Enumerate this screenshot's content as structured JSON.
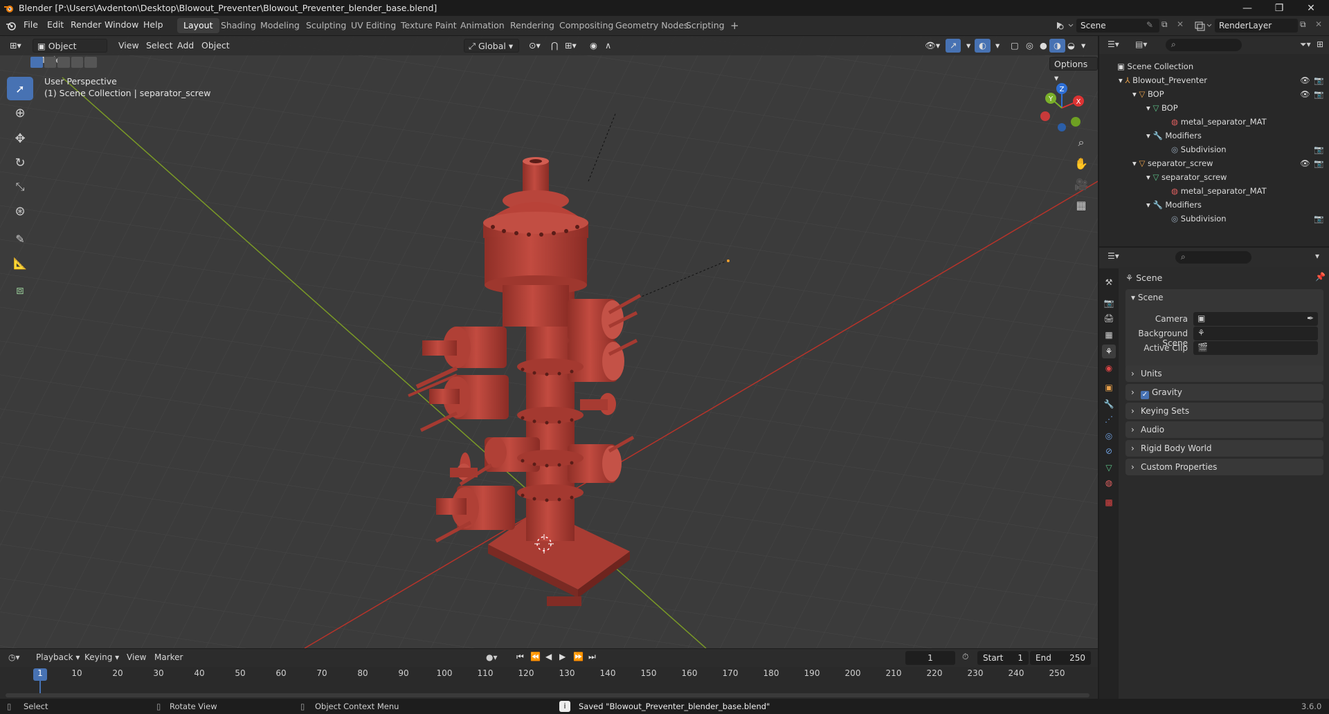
{
  "window": {
    "title": "Blender [P:\\Users\\Avdenton\\Desktop\\Blowout_Preventer\\Blowout_Preventer_blender_base.blend]",
    "minimize": "—",
    "maximize": "❐",
    "close": "✕"
  },
  "menubar": {
    "items": [
      "File",
      "Edit",
      "Render",
      "Window",
      "Help"
    ]
  },
  "workspaces": [
    "Layout",
    "Shading",
    "Modeling",
    "Sculpting",
    "UV Editing",
    "Texture Paint",
    "Animation",
    "Rendering",
    "Compositing",
    "Geometry Nodes",
    "Scripting"
  ],
  "active_workspace": "Layout",
  "scene_field": "Scene",
  "renderlayer_field": "RenderLayer",
  "viewport": {
    "mode": "Object Mode",
    "menus": [
      "View",
      "Select",
      "Add",
      "Object"
    ],
    "transform_orientation": "Global",
    "options_label": "Options",
    "overlay_text_1": "User Perspective",
    "overlay_text_2": "(1) Scene Collection | separator_screw",
    "gizmo": {
      "x": "X",
      "y": "Y",
      "z": "Z"
    }
  },
  "outliner": {
    "rows": [
      {
        "label": "Scene Collection",
        "icon": "collection-icon"
      },
      {
        "label": "Blowout_Preventer",
        "icon": "empty-icon"
      },
      {
        "label": "BOP",
        "icon": "mesh-object-icon"
      },
      {
        "label": "BOP",
        "icon": "mesh-data-icon"
      },
      {
        "label": "metal_separator_MAT",
        "icon": "material-icon"
      },
      {
        "label": "Modifiers",
        "icon": "wrench-icon"
      },
      {
        "label": "Subdivision",
        "icon": "subdivision-icon"
      },
      {
        "label": "separator_screw",
        "icon": "mesh-object-icon"
      },
      {
        "label": "separator_screw",
        "icon": "mesh-data-icon"
      },
      {
        "label": "metal_separator_MAT",
        "icon": "material-icon"
      },
      {
        "label": "Modifiers",
        "icon": "wrench-icon"
      },
      {
        "label": "Subdivision",
        "icon": "subdivision-icon"
      }
    ]
  },
  "properties": {
    "header_title": "Scene",
    "scene_panel": {
      "title": "Scene",
      "camera_label": "Camera",
      "background_scene_label": "Background Scene",
      "active_clip_label": "Active Clip"
    },
    "collapsed_panels": [
      "Units",
      "Gravity",
      "Keying Sets",
      "Audio",
      "Rigid Body World",
      "Custom Properties"
    ],
    "gravity_checked": true
  },
  "timeline": {
    "menus": [
      "Playback",
      "Keying",
      "View",
      "Marker"
    ],
    "current_frame": "1",
    "start_label": "Start",
    "start_value": "1",
    "end_label": "End",
    "end_value": "250",
    "ticks": [
      "1",
      "10",
      "20",
      "30",
      "40",
      "50",
      "60",
      "70",
      "80",
      "90",
      "100",
      "110",
      "120",
      "130",
      "140",
      "150",
      "160",
      "170",
      "180",
      "190",
      "200",
      "210",
      "220",
      "230",
      "240",
      "250"
    ]
  },
  "statusbar": {
    "select": "Select",
    "rotate_view": "Rotate View",
    "context_menu": "Object Context Menu",
    "message": "Saved \"Blowout_Preventer_blender_base.blend\"",
    "version": "3.6.0"
  },
  "colors": {
    "accent": "#4772b3",
    "model_red": "#b8453b",
    "x_axis": "#c0392b",
    "y_axis": "#7fa02a"
  }
}
